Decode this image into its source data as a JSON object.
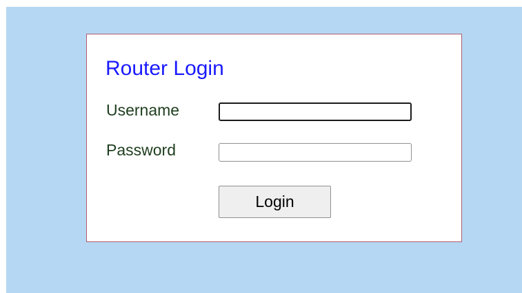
{
  "page": {
    "background_color": "#b5d7f3"
  },
  "login_panel": {
    "title": "Router Login",
    "title_color": "#1a1aff",
    "border_color": "#b35a6a",
    "username": {
      "label": "Username",
      "value": "",
      "focused": true
    },
    "password": {
      "label": "Password",
      "value": ""
    },
    "login_button_label": "Login"
  }
}
